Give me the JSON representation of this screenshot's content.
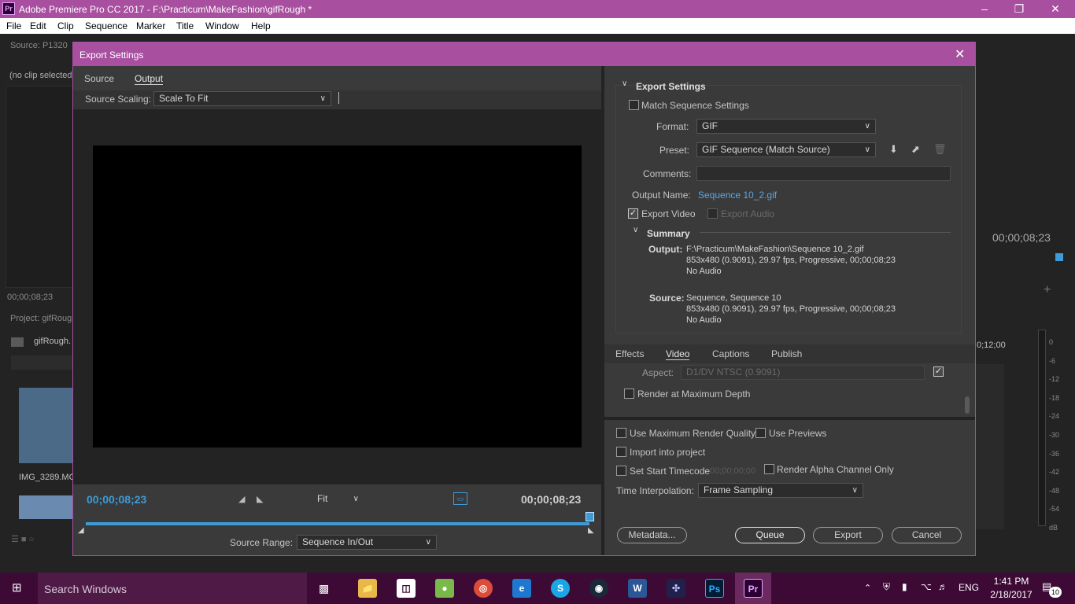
{
  "window": {
    "title": "Adobe Premiere Pro CC 2017 - F:\\Practicum\\MakeFashion\\gifRough *",
    "app_icon": "Pr"
  },
  "menu": [
    "File",
    "Edit",
    "Clip",
    "Sequence",
    "Marker",
    "Title",
    "Window",
    "Help"
  ],
  "background": {
    "source_label": "Source: P1320",
    "no_clip": "(no clip selected)",
    "timecode_left": "00;00;08;23",
    "project_label": "Project: gifRough",
    "project_file": "gifRough.",
    "clip1": "IMG_3289.MC",
    "timecode_right": "00;00;08;23",
    "timeline_tc": "0;12;00",
    "meter_ticks": [
      "0",
      "-6",
      "-12",
      "-18",
      "-24",
      "-30",
      "-36",
      "-42",
      "-48",
      "-54",
      "dB"
    ]
  },
  "dialog": {
    "title": "Export Settings",
    "left_tabs": [
      "Source",
      "Output"
    ],
    "source_scaling_label": "Source Scaling:",
    "source_scaling_value": "Scale To Fit",
    "timecode_in": "00;00;08;23",
    "timecode_out": "00;00;08;23",
    "fit_value": "Fit",
    "source_range_label": "Source Range:",
    "source_range_value": "Sequence In/Out",
    "export_settings_heading": "Export Settings",
    "match_sequence": "Match Sequence Settings",
    "format_label": "Format:",
    "format_value": "GIF",
    "preset_label": "Preset:",
    "preset_value": "GIF Sequence (Match Source)",
    "comments_label": "Comments:",
    "comments_value": "",
    "output_name_label": "Output Name:",
    "output_name_value": "Sequence 10_2.gif",
    "export_video": "Export Video",
    "export_audio": "Export Audio",
    "summary_heading": "Summary",
    "summary_output_label": "Output:",
    "summary_output_lines": [
      "F:\\Practicum\\MakeFashion\\Sequence 10_2.gif",
      "853x480 (0.9091), 29.97 fps, Progressive, 00;00;08;23",
      "No Audio"
    ],
    "summary_source_label": "Source:",
    "summary_source_lines": [
      "Sequence, Sequence 10",
      "853x480 (0.9091), 29.97 fps, Progressive, 00;00;08;23",
      "No Audio"
    ],
    "right_tabs": [
      "Effects",
      "Video",
      "Captions",
      "Publish"
    ],
    "aspect_label": "Aspect:",
    "aspect_value": "D1/DV NTSC (0.9091)",
    "render_max_depth": "Render at Maximum Depth",
    "use_max_render_quality": "Use Maximum Render Quality",
    "use_previews": "Use Previews",
    "import_into_project": "Import into project",
    "set_start_timecode": "Set Start Timecode",
    "start_timecode_value": "00;00;00;00",
    "render_alpha": "Render Alpha Channel Only",
    "time_interp_label": "Time Interpolation:",
    "time_interp_value": "Frame Sampling",
    "btn_metadata": "Metadata...",
    "btn_queue": "Queue",
    "btn_export": "Export",
    "btn_cancel": "Cancel"
  },
  "taskbar": {
    "search": "Search Windows",
    "language": "ENG",
    "time": "1:41 PM",
    "date": "2/18/2017",
    "notifications": "10"
  },
  "colors": {
    "accent_purple": "#a84fa0",
    "timecode_blue": "#3e9bd6",
    "link_blue": "#5aa6e6"
  }
}
